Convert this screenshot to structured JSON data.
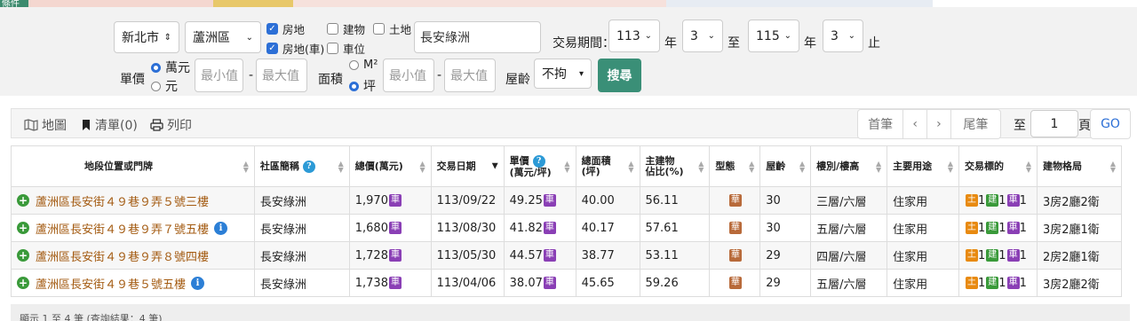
{
  "top": {
    "tag_label": "條件"
  },
  "filter": {
    "city": "新北市",
    "district": "蘆洲區",
    "types": [
      {
        "label": "房地",
        "checked": true
      },
      {
        "label": "建物",
        "checked": false
      },
      {
        "label": "土地",
        "checked": false
      },
      {
        "label": "房地(車)",
        "checked": true
      },
      {
        "label": "車位",
        "checked": false
      }
    ],
    "keyword": "長安綠洲",
    "period_label": "交易期間：",
    "from_year": "113",
    "year_unit": "年",
    "from_month": "3",
    "to_label": "至",
    "to_year": "115",
    "to_month": "3",
    "end_label": "止",
    "price_label": "單價",
    "price_units": [
      {
        "label": "萬元",
        "checked": true
      },
      {
        "label": "元",
        "checked": false
      }
    ],
    "min_placeholder": "最小值",
    "max_placeholder": "最大值",
    "range_sep": "-",
    "area_label": "面積",
    "area_units": [
      {
        "label": "M²",
        "checked": false
      },
      {
        "label": "坪",
        "checked": true
      }
    ],
    "age_label": "屋齡",
    "age_value": "不拘",
    "search_label": "搜尋"
  },
  "toolbar": {
    "map_label": "地圖",
    "list_label": "清單(0)",
    "print_label": "列印",
    "first_label": "首筆",
    "prev_label": "‹",
    "next_label": "›",
    "last_label": "尾筆",
    "goto_label": "至",
    "page_value": "1",
    "page_unit": "頁",
    "go_label": "GO"
  },
  "table": {
    "headers": {
      "address": "地段位置或門牌",
      "community": "社區簡稱",
      "total": "總價(萬元)",
      "date": "交易日期",
      "unit_price_1": "單價",
      "unit_price_2": "(萬元/坪)",
      "area_1": "總面積",
      "area_2": "(坪)",
      "main_1": "主建物",
      "main_2": "佔比(%)",
      "form": "型態",
      "age": "屋齡",
      "floor": "樓別/樓高",
      "usage": "主要用途",
      "target": "交易標的",
      "layout": "建物格局"
    },
    "badges": {
      "car": "車",
      "hua": "華",
      "tu": "土",
      "jian": "建",
      "che": "車"
    },
    "rows": [
      {
        "address": "蘆洲區長安街４９巷９弄５號三樓",
        "info": false,
        "community": "長安綠洲",
        "total": "1,970",
        "date": "113/09/22",
        "unit_price": "49.25",
        "area": "40.00",
        "main": "56.11",
        "age": "30",
        "floor": "三層/六層",
        "usage": "住家用",
        "tu": "1",
        "jian": "1",
        "che": "1",
        "layout": "3房2廳2衛"
      },
      {
        "address": "蘆洲區長安街４９巷９弄７號五樓",
        "info": true,
        "community": "長安綠洲",
        "total": "1,680",
        "date": "113/08/30",
        "unit_price": "41.82",
        "area": "40.17",
        "main": "57.61",
        "age": "30",
        "floor": "五層/六層",
        "usage": "住家用",
        "tu": "1",
        "jian": "1",
        "che": "1",
        "layout": "3房2廳1衛"
      },
      {
        "address": "蘆洲區長安街４９巷９弄８號四樓",
        "info": false,
        "community": "長安綠洲",
        "total": "1,728",
        "date": "113/05/30",
        "unit_price": "44.57",
        "area": "38.77",
        "main": "53.11",
        "age": "29",
        "floor": "四層/六層",
        "usage": "住家用",
        "tu": "1",
        "jian": "1",
        "che": "1",
        "layout": "2房2廳1衛"
      },
      {
        "address": "蘆洲區長安街４９巷５號五樓",
        "info": true,
        "community": "長安綠洲",
        "total": "1,738",
        "date": "113/04/06",
        "unit_price": "38.07",
        "area": "45.65",
        "main": "59.26",
        "age": "29",
        "floor": "五層/六層",
        "usage": "住家用",
        "tu": "1",
        "jian": "1",
        "che": "1",
        "layout": "3房2廳2衛"
      }
    ]
  },
  "footer": {
    "summary": "顯示 1 至 4 筆 (查詢結果：4 筆)"
  },
  "colors": {
    "accent": "#2c6fd6",
    "search": "#3a8f77",
    "address": "#a35a10"
  }
}
